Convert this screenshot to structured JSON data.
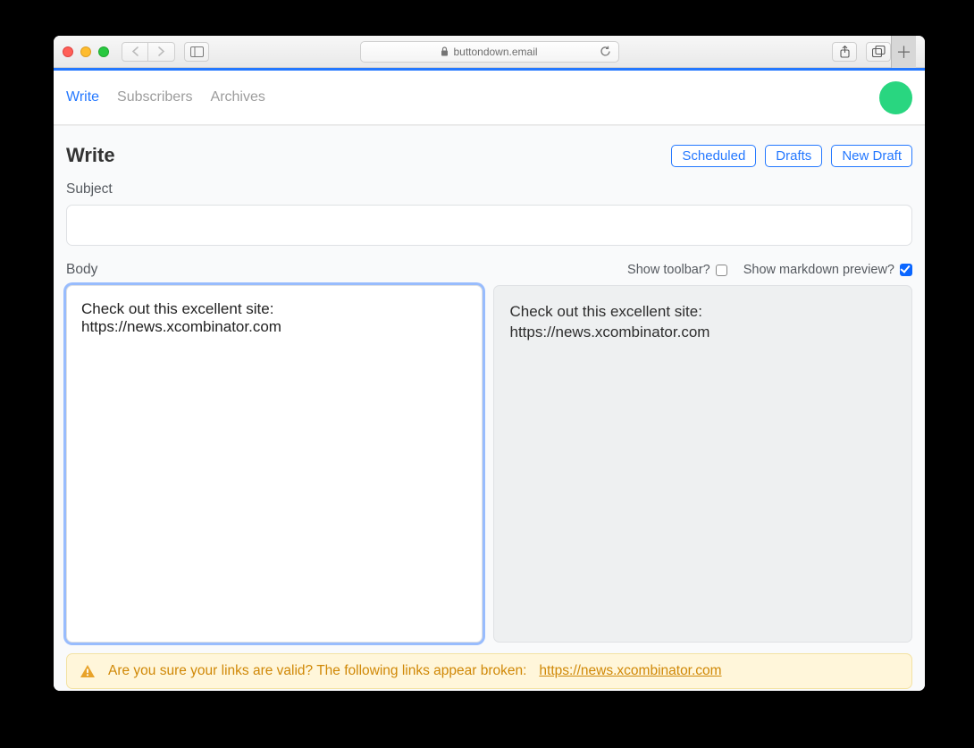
{
  "browser": {
    "url_host": "buttondown.email"
  },
  "nav": {
    "items": [
      "Write",
      "Subscribers",
      "Archives"
    ],
    "active_index": 0
  },
  "page": {
    "title": "Write",
    "buttons": {
      "scheduled": "Scheduled",
      "drafts": "Drafts",
      "new_draft": "New Draft"
    },
    "subject_label": "Subject",
    "subject_value": "",
    "body_label": "Body",
    "show_toolbar_label": "Show toolbar?",
    "show_toolbar_checked": false,
    "show_preview_label": "Show markdown preview?",
    "show_preview_checked": true,
    "body_text": "Check out this excellent site: https://news.xcombinator.com",
    "preview_text": "Check out this excellent site: https://news.xcombinator.com"
  },
  "warning": {
    "message": "Are you sure your links are valid? The following links appear broken:",
    "broken_link": "https://news.xcombinator.com"
  }
}
